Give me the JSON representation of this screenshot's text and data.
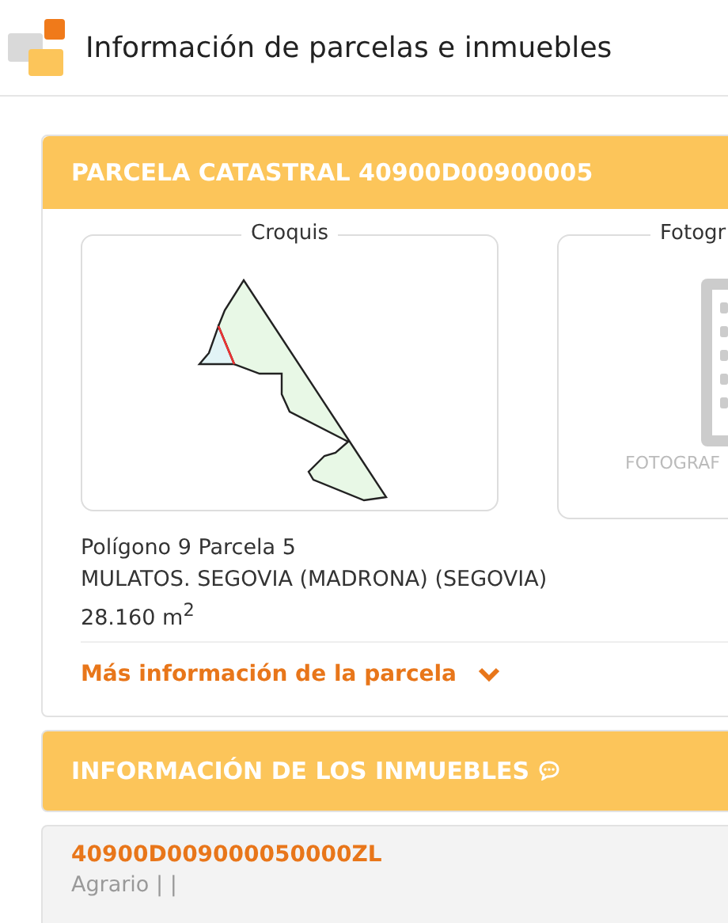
{
  "header": {
    "title": "Información de parcelas e inmuebles"
  },
  "parcel": {
    "title": "PARCELA CATASTRAL 40900D00900005",
    "sketch": {
      "label": "Croquis"
    },
    "photo": {
      "label": "Fotogr",
      "placeholder_text": "FOTOGRAF"
    },
    "lines": [
      "Polígono 9 Parcela 5",
      "MULATOS. SEGOVIA (MADRONA) (SEGOVIA)",
      "28.160 m$^{2}$"
    ],
    "more_link": {
      "label": "Más información de la parcela",
      "expanded": false
    }
  },
  "properties": {
    "title": "INFORMACIÓN DE LOS INMUEBLES",
    "items": [
      {
        "code": "40900D009000050000ZL",
        "detail": "Agrario | |"
      }
    ]
  }
}
